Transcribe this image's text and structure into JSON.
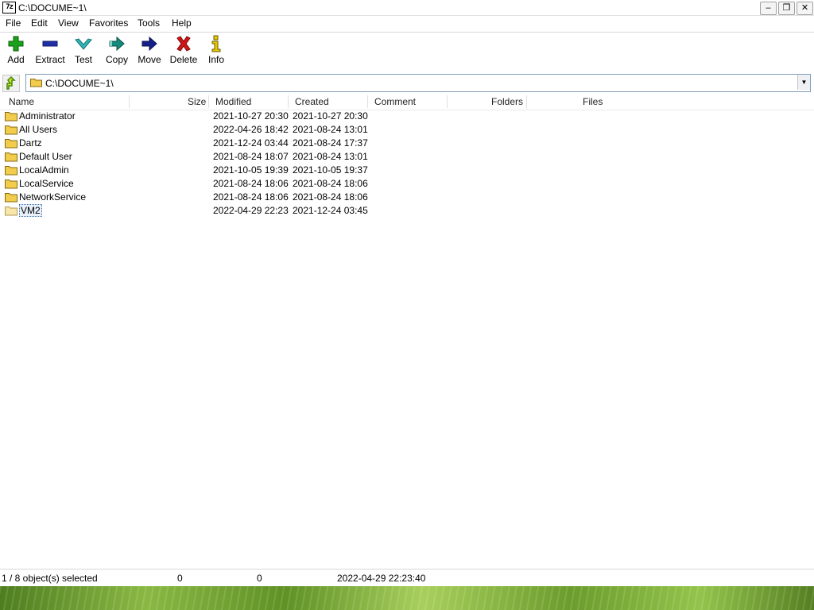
{
  "window": {
    "title": "C:\\DOCUME~1\\",
    "app_icon_text": "7z",
    "controls": {
      "minimize": "–",
      "restore": "❐",
      "close": "✕"
    }
  },
  "menu": [
    "File",
    "Edit",
    "View",
    "Favorites",
    "Tools",
    "Help"
  ],
  "toolbar": [
    {
      "label": "Add",
      "icon": "add-icon"
    },
    {
      "label": "Extract",
      "icon": "extract-icon"
    },
    {
      "label": "Test",
      "icon": "test-icon"
    },
    {
      "label": "Copy",
      "icon": "copy-icon"
    },
    {
      "label": "Move",
      "icon": "move-icon"
    },
    {
      "label": "Delete",
      "icon": "delete-icon"
    },
    {
      "label": "Info",
      "icon": "info-icon"
    }
  ],
  "address": {
    "path": "C:\\DOCUME~1\\"
  },
  "columns": {
    "name": "Name",
    "size": "Size",
    "modified": "Modified",
    "created": "Created",
    "comment": "Comment",
    "folders": "Folders",
    "files": "Files"
  },
  "rows": [
    {
      "name": "Administrator",
      "modified": "2021-10-27 20:30",
      "created": "2021-10-27 20:30"
    },
    {
      "name": "All Users",
      "modified": "2022-04-26 18:42",
      "created": "2021-08-24 13:01"
    },
    {
      "name": "Dartz",
      "modified": "2021-12-24 03:44",
      "created": "2021-08-24 17:37"
    },
    {
      "name": "Default User",
      "modified": "2021-08-24 18:07",
      "created": "2021-08-24 13:01"
    },
    {
      "name": "LocalAdmin",
      "modified": "2021-10-05 19:39",
      "created": "2021-10-05 19:37"
    },
    {
      "name": "LocalService",
      "modified": "2021-08-24 18:06",
      "created": "2021-08-24 18:06"
    },
    {
      "name": "NetworkService",
      "modified": "2021-08-24 18:06",
      "created": "2021-08-24 18:06"
    },
    {
      "name": "VM2",
      "modified": "2022-04-29 22:23",
      "created": "2021-12-24 03:45",
      "selected": true
    }
  ],
  "status": {
    "selection": "1 / 8 object(s) selected",
    "size": "0",
    "packed": "0",
    "modified": "2022-04-29 22:23:40"
  },
  "colors": {
    "folder": "#f2cd4b",
    "add": "#19a319",
    "extract": "#1f2fa8",
    "test": "#2fb7b7",
    "copy": "#138a7e",
    "move": "#15208a",
    "delete": "#d11616",
    "info": "#e6c800"
  }
}
